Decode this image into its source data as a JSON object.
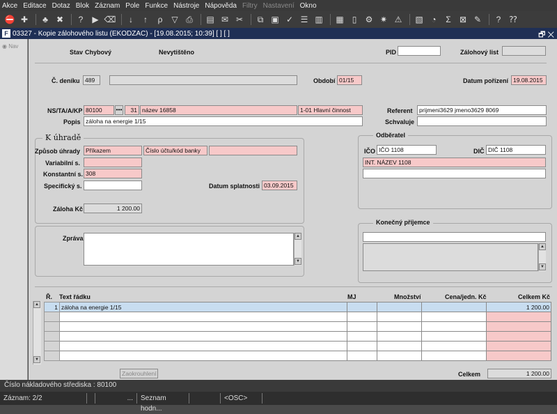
{
  "menu": [
    "Akce",
    "Editace",
    "Dotaz",
    "Blok",
    "Záznam",
    "Pole",
    "Funkce",
    "Nástroje",
    "Nápověda",
    "Filtry",
    "Nastavení",
    "Okno"
  ],
  "menu_disabled": [
    "Filtry",
    "Nastavení"
  ],
  "toolbar_icons": [
    "exit-icon",
    "insert-record-icon",
    "tree-icon",
    "delete-record-icon",
    "query-icon",
    "execute-query-icon",
    "clear-icon",
    "sort-asc-icon",
    "sort-desc-icon",
    "filter-edit-icon",
    "filter-icon",
    "print-icon",
    "print-preview-icon",
    "email-icon",
    "cut-icon",
    "copy-icon",
    "paste-icon",
    "spellcheck-icon",
    "list-icon",
    "columns-icon",
    "calendar-icon",
    "document-icon",
    "settings-icon",
    "star-icon",
    "warning-icon",
    "chart-icon",
    "clock-icon",
    "sigma-icon",
    "excel-icon",
    "note-icon",
    "help-icon",
    "context-help-icon"
  ],
  "window": {
    "title": "03327 - Kopie zálohového listu (EKODZAC) - [19.08.2015; 10:39] [ ] [ ]",
    "controls": "🗗 ✕"
  },
  "nav": {
    "label": "Nav"
  },
  "header": {
    "stav_label": "Stav",
    "stav_value": "Chybový",
    "print_state": "Nevytištěno",
    "pid_label": "PID",
    "pid_value": "",
    "zl_label": "Zálohový list",
    "zl_value": ""
  },
  "row1": {
    "denik_label": "Č. deníku",
    "denik_value": "489",
    "denik_desc": "",
    "obdobi_label": "Období",
    "obdobi_value": "01/15",
    "datum_label": "Datum pořízení",
    "datum_value": "19.08.2015"
  },
  "row2": {
    "ns_label": "NS/TA/A/KP",
    "ns_value": "80100",
    "ns_btn": "•••",
    "ta_value": "31",
    "ta_desc": "název 16858",
    "a_value": "1-01 Hlavní činnost",
    "referent_label": "Referent",
    "referent_value": "prijmeni3629 jmeno3629 8069",
    "popis_label": "Popis",
    "popis_value": "záloha na energie 1/15",
    "schvaluje_label": "Schvaluje",
    "schvaluje_value": ""
  },
  "k_uhrade": {
    "title": "K úhradě",
    "zpusob_label": "Způsob úhrady",
    "zpusob_value": "Příkazem",
    "ucet_value": "Číslo účtu/kód banky",
    "ucet2_value": "",
    "vs_label": "Variabilní s.",
    "vs_value": "",
    "ks_label": "Konstantní s.",
    "ks_value": "308",
    "ss_label": "Specifický s.",
    "ss_value": "",
    "splatnost_label": "Datum splatnosti",
    "splatnost_value": "03.09.2015",
    "zaloha_label": "Záloha Kč",
    "zaloha_value": "1 200.00"
  },
  "odberatel": {
    "title": "Odběratel",
    "ico_label": "IČO",
    "ico_value": "IČO 1108",
    "dic_label": "DIČ",
    "dic_value": "DIČ 1108",
    "name_value": "INT. NÁZEV 1108",
    "addr_value": ""
  },
  "zprava": {
    "label": "Zpráva",
    "value": ""
  },
  "prijemce": {
    "title": "Konečný příjemce",
    "line1": "",
    "text": ""
  },
  "grid": {
    "headers": {
      "r": "Ř.",
      "text": "Text řádku",
      "mj": "MJ",
      "mnozstvi": "Množství",
      "cena": "Cena/jedn. Kč",
      "celkem": "Celkem Kč"
    },
    "rows": [
      {
        "r": "1",
        "text": "záloha na energie 1/15",
        "mj": "",
        "mnozstvi": "",
        "cena": "",
        "celkem": "1 200.00"
      },
      {
        "r": "",
        "text": "",
        "mj": "",
        "mnozstvi": "",
        "cena": "",
        "celkem": ""
      },
      {
        "r": "",
        "text": "",
        "mj": "",
        "mnozstvi": "",
        "cena": "",
        "celkem": ""
      },
      {
        "r": "",
        "text": "",
        "mj": "",
        "mnozstvi": "",
        "cena": "",
        "celkem": ""
      },
      {
        "r": "",
        "text": "",
        "mj": "",
        "mnozstvi": "",
        "cena": "",
        "celkem": ""
      },
      {
        "r": "",
        "text": "",
        "mj": "",
        "mnozstvi": "",
        "cena": "",
        "celkem": ""
      }
    ]
  },
  "footer": {
    "round_btn": "Zaokrouhlení",
    "celkem_label": "Celkem",
    "celkem_value": "1 200.00"
  },
  "status": {
    "line1": "Číslo nákladového střediska : 80100",
    "record": "Záznam: 2/2",
    "s2": "",
    "s3": "...",
    "s4": "Seznam hodn...",
    "s5": "",
    "s6": "<OSC>"
  },
  "colors": {
    "required": "#f7c9c9",
    "selected_row": "#c8ddf0",
    "title_bar": "#1f2f55"
  }
}
